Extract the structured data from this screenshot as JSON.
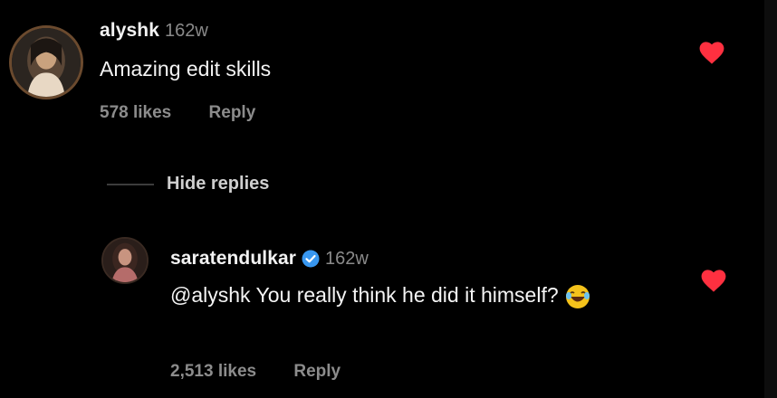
{
  "comments": [
    {
      "username": "alyshk",
      "time": "162w",
      "text": "Amazing edit skills",
      "likes": "578 likes",
      "reply_label": "Reply",
      "liked": true,
      "avatar_icon": "profile-photo"
    },
    {
      "username": "saratendulkar",
      "verified": true,
      "time": "162w",
      "text": "@alyshk You really think he did it himself?",
      "emoji": "laughing-crying-emoji",
      "likes": "2,513 likes",
      "reply_label": "Reply",
      "liked": true,
      "avatar_icon": "profile-photo"
    }
  ],
  "replies_toggle": {
    "label": "Hide replies"
  },
  "colors": {
    "background": "#000000",
    "heart": "#ff3040",
    "verified": "#3897f0",
    "muted": "#8c8c8c"
  }
}
